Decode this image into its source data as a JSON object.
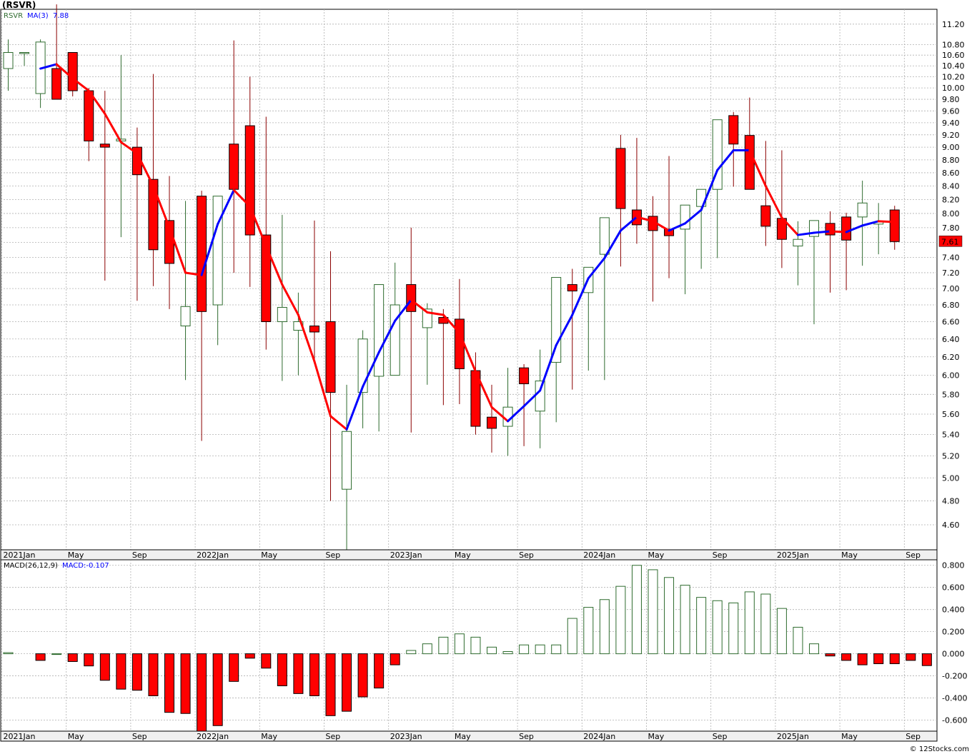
{
  "ticker_title": "(RSVR)",
  "watermark": "© 12Stocks.com",
  "colors": {
    "up": "#2e6b2e",
    "down": "#ff0000",
    "ma_up": "#0000ff",
    "ma_down": "#ff0000",
    "grid": "#b0b0b0",
    "frame": "#000000",
    "last_price_bg": "#ff0000"
  },
  "chart_data": [
    {
      "type": "candlestick",
      "legend": {
        "symbol": "RSVR",
        "ma_label": "MA(3)",
        "ma_value": "7.88"
      },
      "last_price": "7.61",
      "months": [
        "2021Jan",
        "2021Feb",
        "2021Mar",
        "2021Apr",
        "2021May",
        "2021Jun",
        "2021Jul",
        "2021Aug",
        "2021Sep",
        "2021Oct",
        "2021Nov",
        "2021Dec",
        "2022Jan",
        "2022Feb",
        "2022Mar",
        "2022Apr",
        "2022May",
        "2022Jun",
        "2022Jul",
        "2022Aug",
        "2022Sep",
        "2022Oct",
        "2022Nov",
        "2022Dec",
        "2023Jan",
        "2023Feb",
        "2023Mar",
        "2023Apr",
        "2023May",
        "2023Jun",
        "2023Jul",
        "2023Aug",
        "2023Sep",
        "2023Oct",
        "2023Nov",
        "2023Dec",
        "2024Jan",
        "2024Feb",
        "2024Mar",
        "2024Apr",
        "2024May",
        "2024Jun",
        "2024Jul",
        "2024Aug",
        "2024Sep",
        "2024Oct",
        "2024Nov",
        "2024Dec",
        "2025Jan",
        "2025Feb",
        "2025Mar",
        "2025Apr",
        "2025May",
        "2025Jun",
        "2025Jul",
        "2025Aug",
        "2025Sep",
        "2025Oct"
      ],
      "open": [
        10.35,
        10.65,
        9.9,
        10.35,
        10.65,
        9.95,
        9.05,
        9.1,
        9.0,
        8.5,
        7.9,
        6.55,
        8.25,
        6.8,
        9.05,
        9.35,
        7.7,
        6.6,
        6.5,
        6.55,
        6.6,
        4.9,
        5.82,
        5.99,
        6.0,
        7.05,
        6.53,
        6.65,
        6.63,
        6.05,
        5.57,
        5.48,
        6.08,
        5.63,
        6.14,
        7.05,
        6.95,
        7.44,
        8.98,
        8.05,
        7.96,
        7.78,
        7.78,
        8.1,
        8.35,
        9.52,
        9.19,
        8.11,
        7.93,
        7.55,
        7.68,
        7.86,
        7.95,
        7.95,
        7.85,
        8.05
      ],
      "high": [
        10.9,
        10.65,
        10.9,
        11.6,
        10.65,
        10.0,
        9.95,
        10.6,
        9.32,
        10.25,
        8.55,
        8.18,
        8.33,
        7.9,
        10.88,
        10.2,
        9.5,
        7.98,
        6.95,
        7.9,
        7.48,
        5.9,
        6.5,
        6.71,
        7.33,
        7.8,
        6.82,
        6.75,
        7.12,
        6.25,
        5.9,
        6.08,
        6.12,
        6.28,
        6.23,
        7.25,
        6.98,
        7.48,
        9.2,
        9.15,
        8.25,
        8.86,
        8.03,
        8.17,
        9.2,
        9.58,
        9.83,
        9.1,
        8.95,
        7.89,
        7.7,
        8.03,
        8.01,
        8.48,
        8.15,
        8.11
      ],
      "low": [
        9.95,
        10.4,
        9.65,
        9.85,
        9.85,
        8.78,
        7.1,
        7.67,
        6.85,
        7.03,
        6.75,
        5.95,
        5.34,
        6.33,
        7.2,
        7.02,
        6.28,
        5.94,
        6.0,
        6.15,
        4.8,
        4.4,
        5.46,
        5.43,
        6.43,
        5.42,
        5.9,
        5.69,
        5.7,
        5.4,
        5.23,
        5.2,
        5.29,
        5.27,
        5.52,
        5.85,
        6.05,
        5.95,
        7.28,
        7.58,
        6.84,
        7.13,
        6.93,
        7.25,
        7.39,
        8.39,
        8.55,
        7.55,
        7.26,
        7.04,
        6.57,
        6.95,
        6.98,
        7.29,
        7.44,
        7.5
      ],
      "close": [
        10.65,
        10.65,
        10.85,
        9.8,
        9.95,
        9.1,
        9.0,
        9.13,
        8.57,
        7.5,
        7.32,
        6.78,
        6.72,
        8.25,
        8.35,
        7.7,
        6.6,
        6.77,
        6.6,
        6.48,
        5.82,
        5.43,
        6.4,
        7.05,
        6.8,
        6.72,
        6.75,
        6.58,
        6.07,
        5.48,
        5.46,
        5.67,
        5.91,
        5.94,
        7.14,
        6.97,
        7.27,
        7.94,
        8.07,
        7.84,
        7.76,
        7.69,
        8.12,
        8.35,
        9.45,
        9.05,
        8.35,
        7.82,
        7.64,
        7.64,
        7.9,
        7.7,
        7.63,
        8.15,
        7.88,
        7.61
      ],
      "ma3": [
        null,
        null,
        10.35,
        10.43,
        10.17,
        9.95,
        9.55,
        9.08,
        8.9,
        8.4,
        7.8,
        7.2,
        7.17,
        7.85,
        8.34,
        8.1,
        7.55,
        7.05,
        6.68,
        6.15,
        5.58,
        5.45,
        5.88,
        6.25,
        6.61,
        6.86,
        6.71,
        6.68,
        6.47,
        6.04,
        5.67,
        5.53,
        5.68,
        5.84,
        6.33,
        6.68,
        7.13,
        7.39,
        7.76,
        7.95,
        7.89,
        7.76,
        7.86,
        8.05,
        8.64,
        8.95,
        8.95,
        8.4,
        7.94,
        7.7,
        7.73,
        7.75,
        7.74,
        7.83,
        7.89,
        7.88
      ],
      "ylim": [
        4.4,
        11.5
      ],
      "yticks": [
        "4.60",
        "4.80",
        "5.00",
        "5.20",
        "5.40",
        "5.60",
        "5.80",
        "6.00",
        "6.20",
        "6.40",
        "6.60",
        "6.80",
        "7.00",
        "7.20",
        "7.40",
        "7.60",
        "7.80",
        "8.00",
        "8.20",
        "8.40",
        "8.60",
        "8.80",
        "9.00",
        "9.20",
        "9.40",
        "9.60",
        "9.80",
        "10.00",
        "10.20",
        "10.40",
        "10.60",
        "10.80",
        "11.20"
      ],
      "xticks": [
        "2021Jan",
        "May",
        "Sep",
        "2022Jan",
        "May",
        "Sep",
        "2023Jan",
        "May",
        "Sep",
        "2024Jan",
        "May",
        "Sep",
        "2025Jan",
        "May",
        "Sep"
      ],
      "scale": "log",
      "grid": true
    },
    {
      "type": "bar",
      "legend": {
        "label": "MACD(26,12,9)",
        "value_label": "MACD:-0.107"
      },
      "values": [
        0.01,
        null,
        -0.06,
        0.0,
        -0.07,
        -0.11,
        -0.24,
        -0.32,
        -0.33,
        -0.38,
        -0.53,
        -0.54,
        -0.7,
        -0.65,
        -0.25,
        -0.04,
        -0.13,
        -0.29,
        -0.36,
        -0.38,
        -0.56,
        -0.52,
        -0.39,
        -0.31,
        -0.1,
        0.03,
        0.09,
        0.15,
        0.18,
        0.15,
        0.06,
        0.02,
        0.08,
        0.08,
        0.08,
        0.32,
        0.42,
        0.49,
        0.61,
        0.8,
        0.76,
        0.69,
        0.62,
        0.51,
        0.48,
        0.46,
        0.56,
        0.54,
        0.41,
        0.24,
        0.09,
        -0.02,
        -0.06,
        -0.1,
        -0.09,
        -0.09,
        -0.06,
        -0.107
      ],
      "ylim": [
        -0.7,
        0.85
      ],
      "yticks": [
        "-0.600",
        "-0.400",
        "-0.200",
        "0.000",
        "0.200",
        "0.400",
        "0.600",
        "0.800"
      ],
      "xticks": [
        "2021Jan",
        "May",
        "Sep",
        "2022Jan",
        "May",
        "Sep",
        "2023Jan",
        "May",
        "Sep",
        "2024Jan",
        "May",
        "Sep",
        "2025Jan",
        "May",
        "Sep"
      ],
      "grid": true
    }
  ]
}
